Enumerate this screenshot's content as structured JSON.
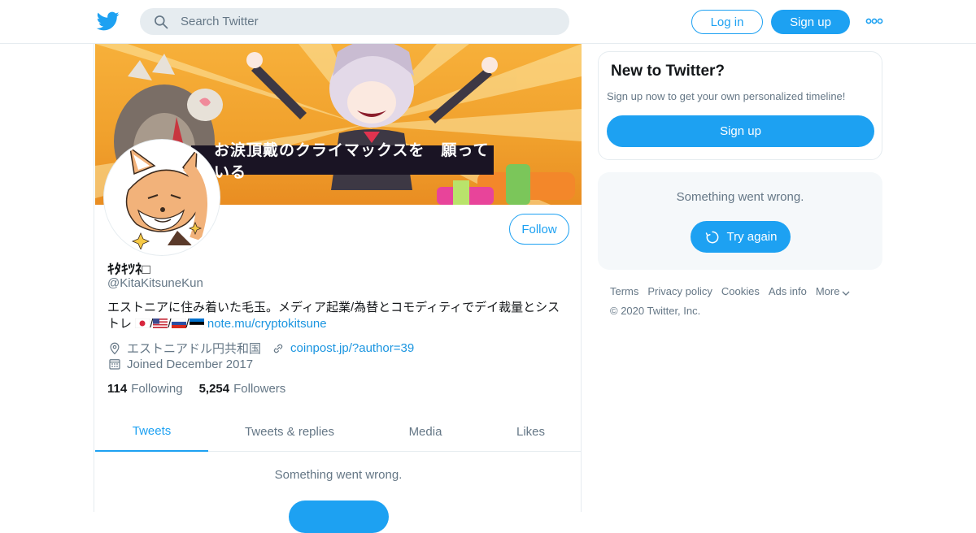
{
  "header": {
    "logo_icon": "twitter-bird-icon",
    "search": {
      "placeholder": "Search Twitter",
      "icon": "search-icon"
    },
    "login_label": "Log in",
    "signup_label": "Sign up",
    "more_icon": "more-dots-icon"
  },
  "profile": {
    "banner_caption": "お涙頂戴のクライマックスを　願っている",
    "follow_label": "Follow",
    "display_name": "ｷﾀｷﾂﾈ□",
    "handle": "@KitaKitsuneKun",
    "bio_text": "エストニアに住み着いた毛玉。メディア起業/為替とコモディティでデイ裁量とシストレ",
    "bio_flags": [
      "japan-flag",
      "usa-flag",
      "russia-flag",
      "estonia-flag"
    ],
    "bio_separator": "/",
    "bio_link": "note.mu/cryptokitsune",
    "location": "エストニアドル円共和国",
    "website": "coinpost.jp/?author=39",
    "joined": "Joined December 2017",
    "following_count": "114",
    "following_label": "Following",
    "followers_count": "5,254",
    "followers_label": "Followers"
  },
  "tabs": [
    {
      "label": "Tweets",
      "active": true
    },
    {
      "label": "Tweets & replies",
      "active": false
    },
    {
      "label": "Media",
      "active": false
    },
    {
      "label": "Likes",
      "active": false
    }
  ],
  "timeline": {
    "error_text": "Something went wrong."
  },
  "sidebar": {
    "new_title": "New to Twitter?",
    "new_subtitle": "Sign up now to get your own personalized timeline!",
    "new_signup_label": "Sign up",
    "error_text": "Something went wrong.",
    "try_again_label": "Try again"
  },
  "footer": {
    "links": [
      "Terms",
      "Privacy policy",
      "Cookies",
      "Ads info",
      "More"
    ],
    "copyright": "© 2020 Twitter, Inc."
  },
  "colors": {
    "brand": "#1da1f2",
    "link": "#1b95e0",
    "muted": "#657786",
    "border": "#e6ecf0"
  }
}
